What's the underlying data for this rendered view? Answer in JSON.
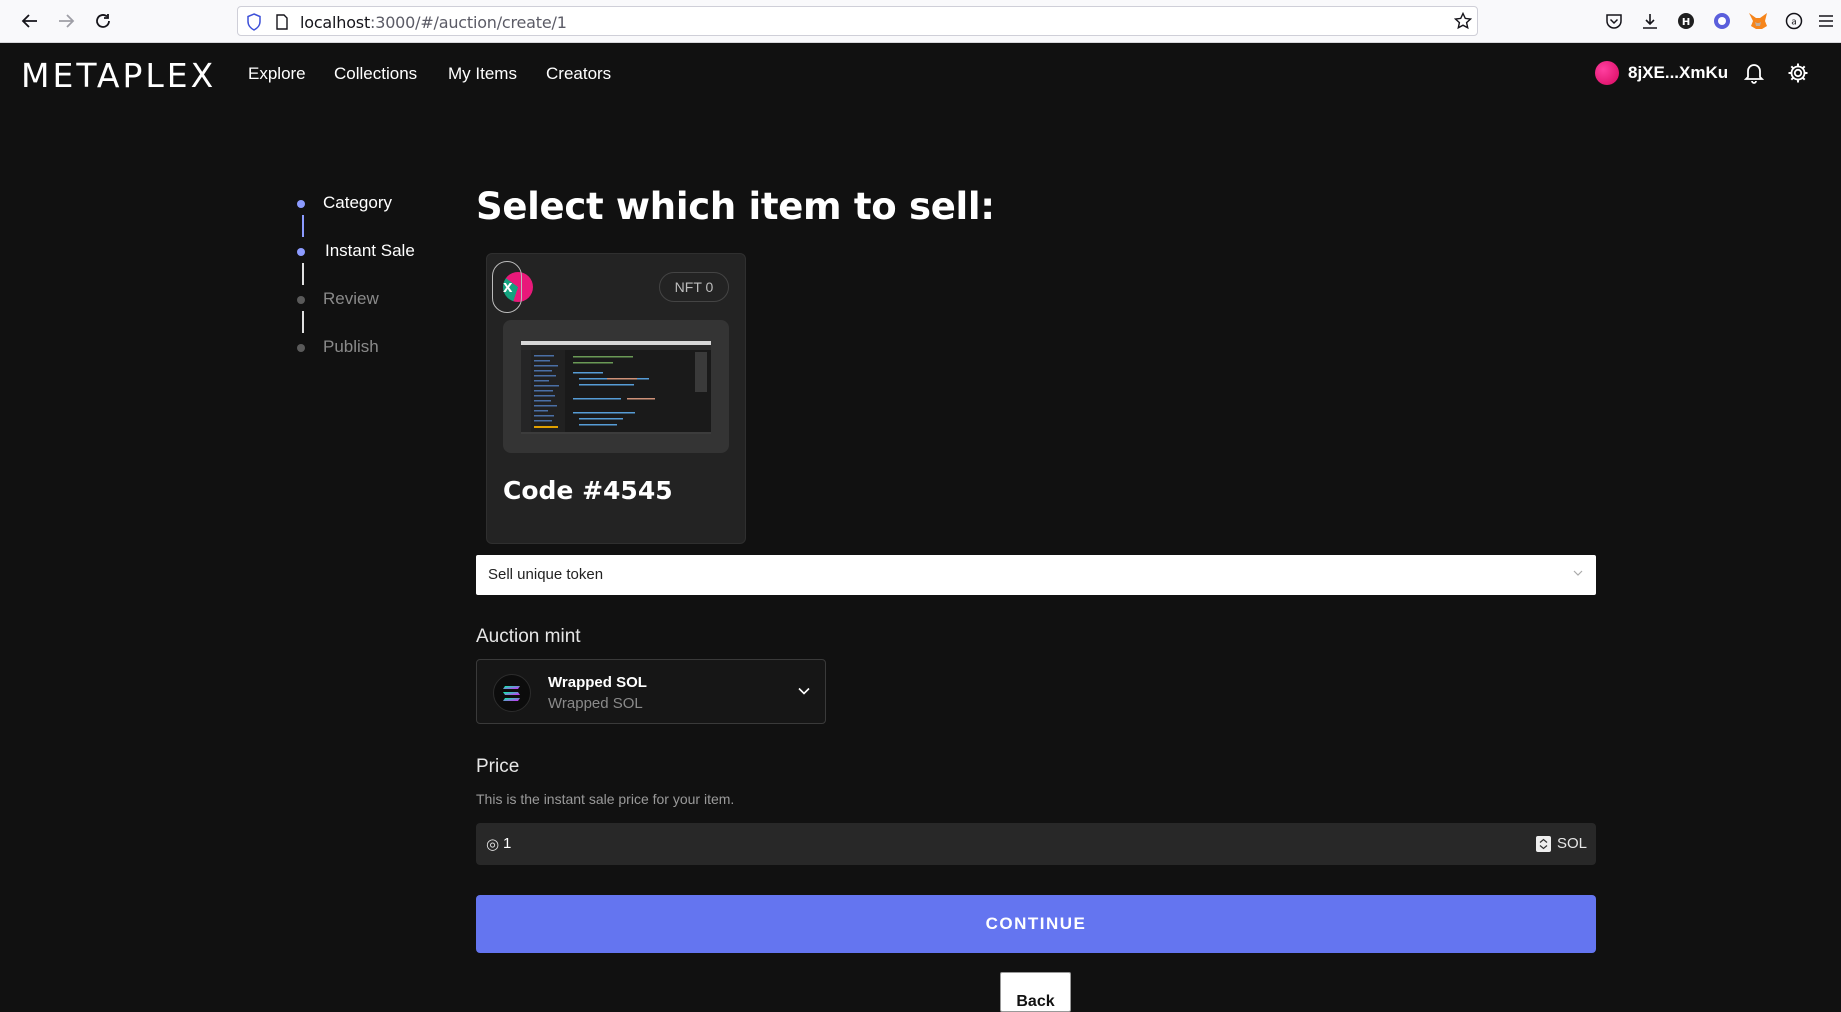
{
  "browser": {
    "url_host": "localhost",
    "url_rest": ":3000/#/auction/create/1"
  },
  "app": {
    "logo": "METAPLEX",
    "nav": [
      "Explore",
      "Collections",
      "My Items",
      "Creators"
    ],
    "wallet_address": "8jXE...XmKu"
  },
  "steps": [
    {
      "label": "Category",
      "state": "done"
    },
    {
      "label": "Instant Sale",
      "state": "current"
    },
    {
      "label": "Review",
      "state": "pending"
    },
    {
      "label": "Publish",
      "state": "pending"
    }
  ],
  "main": {
    "heading": "Select which item to sell:",
    "item": {
      "remove_label": "x",
      "badge": "NFT 0",
      "title": "Code #4545"
    },
    "sale_type": "Sell unique token",
    "auction_mint": {
      "label": "Auction mint",
      "token_name": "Wrapped SOL",
      "token_sub": "Wrapped SOL"
    },
    "price": {
      "label": "Price",
      "help": "This is the instant sale price for your item.",
      "prefix": "◎",
      "value": "1",
      "unit": "SOL"
    },
    "continue_label": "CONTINUE",
    "back_label": "Back"
  },
  "colors": {
    "background": "#111111",
    "accent": "#6475f0",
    "step_active_dot": "#8c9bff",
    "step_inactive": "#5a5a5a"
  }
}
